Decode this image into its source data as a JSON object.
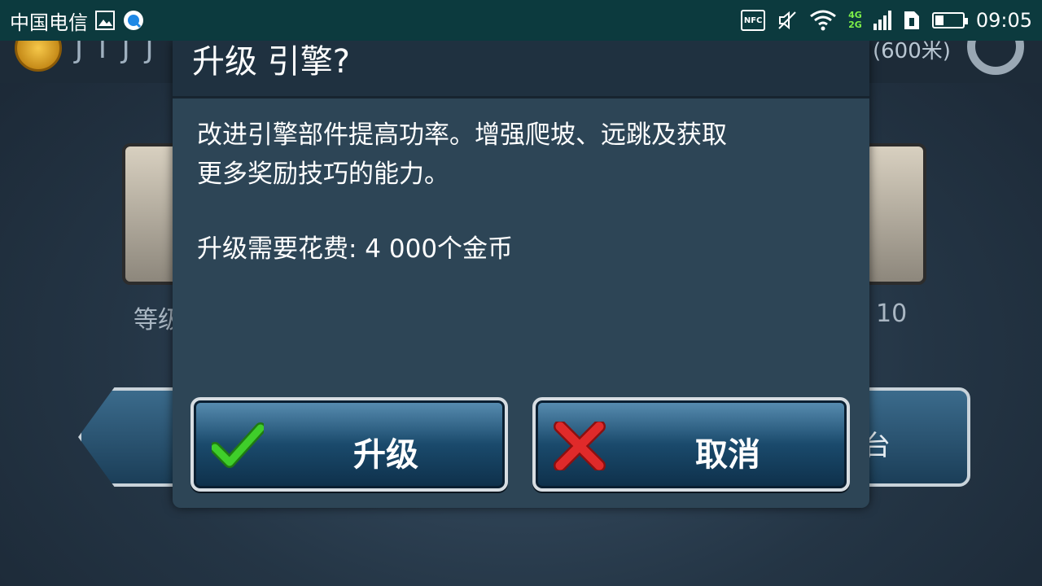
{
  "status_bar": {
    "carrier": "中国电信",
    "network_top": "4G",
    "network_bottom": "2G",
    "nfc_label": "NFC",
    "time": "09:05"
  },
  "background": {
    "distance": "(600米)",
    "level_left": "等级",
    "level_right": "10",
    "right_button_label": "台"
  },
  "dialog": {
    "title": "升级 引擎?",
    "body_line1": "改进引擎部件提高功率。增强爬坡、远跳及获取",
    "body_line2": "更多奖励技巧的能力。",
    "cost": "升级需要花费: 4 000个金币",
    "upgrade_label": "升级",
    "cancel_label": "取消"
  },
  "colors": {
    "status_bar": "#0c3a3e",
    "dialog": "#2d4556",
    "checkmark": "#3fce2a",
    "cross": "#e02a2a"
  }
}
